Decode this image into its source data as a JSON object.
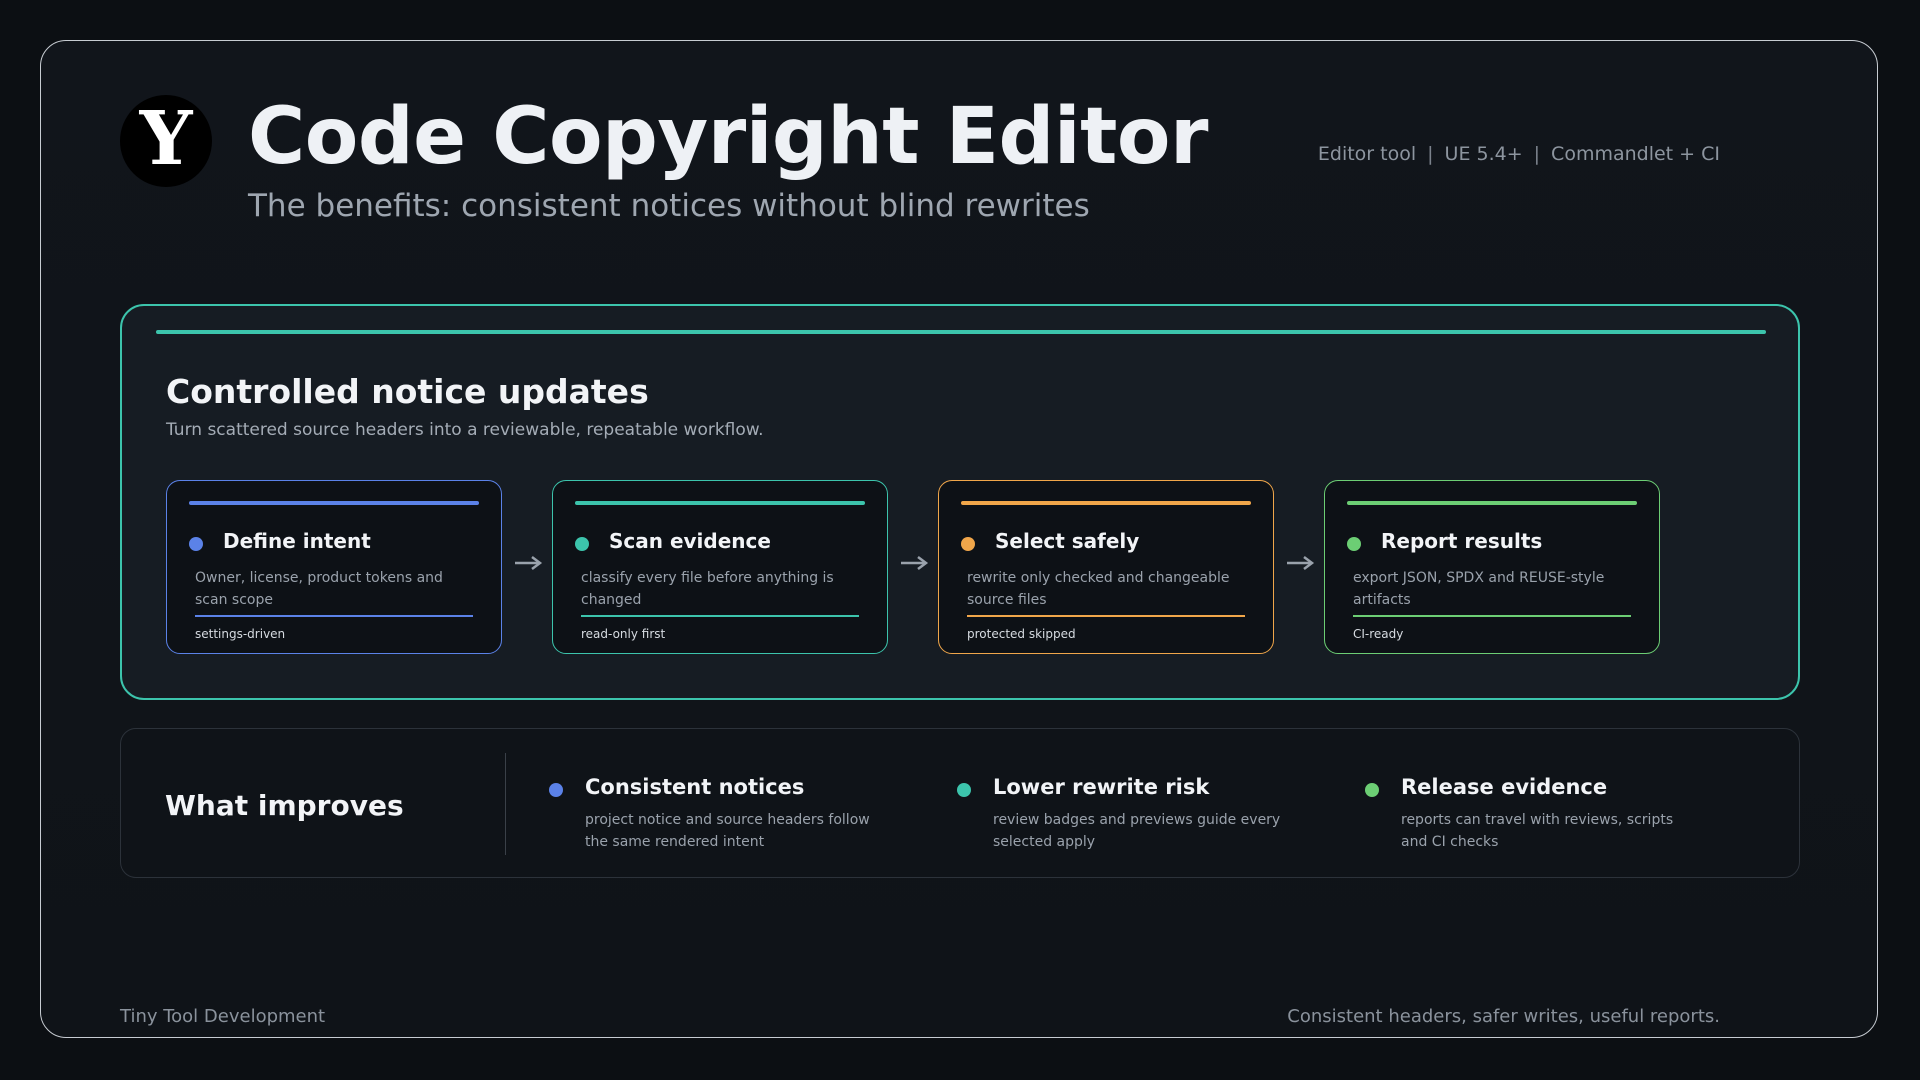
{
  "header": {
    "logo_letter": "Y",
    "title": "Code Copyright Editor",
    "subtitle": "The benefits: consistent notices without blind rewrites",
    "meta": [
      "Editor tool",
      "UE 5.4+",
      "Commandlet + CI"
    ],
    "meta_separator": "|"
  },
  "workflow": {
    "title": "Controlled notice updates",
    "description": "Turn scattered source headers into a reviewable, repeatable workflow.",
    "accent_color": "#3cc4ac",
    "steps": [
      {
        "title": "Define intent",
        "description": "Owner, license, product tokens and scan scope",
        "tag": "settings-driven",
        "color": "#5b82e8"
      },
      {
        "title": "Scan evidence",
        "description": "classify every file before anything is changed",
        "tag": "read-only first",
        "color": "#3cc4ac"
      },
      {
        "title": "Select safely",
        "description": "rewrite only checked and changeable source files",
        "tag": "protected skipped",
        "color": "#f0a64a"
      },
      {
        "title": "Report results",
        "description": "export JSON, SPDX and REUSE-style artifacts",
        "tag": "CI-ready",
        "color": "#6cce74"
      }
    ]
  },
  "improvements": {
    "title": "What improves",
    "items": [
      {
        "title": "Consistent notices",
        "description": "project notice and source headers follow the same rendered intent",
        "color": "#5b82e8"
      },
      {
        "title": "Lower rewrite risk",
        "description": "review badges and previews guide every selected apply",
        "color": "#3cc4ac"
      },
      {
        "title": "Release evidence",
        "description": "reports can travel with reviews, scripts and CI checks",
        "color": "#6cce74"
      }
    ]
  },
  "footer": {
    "left": "Tiny Tool Development",
    "right": "Consistent headers, safer writes, useful reports."
  }
}
